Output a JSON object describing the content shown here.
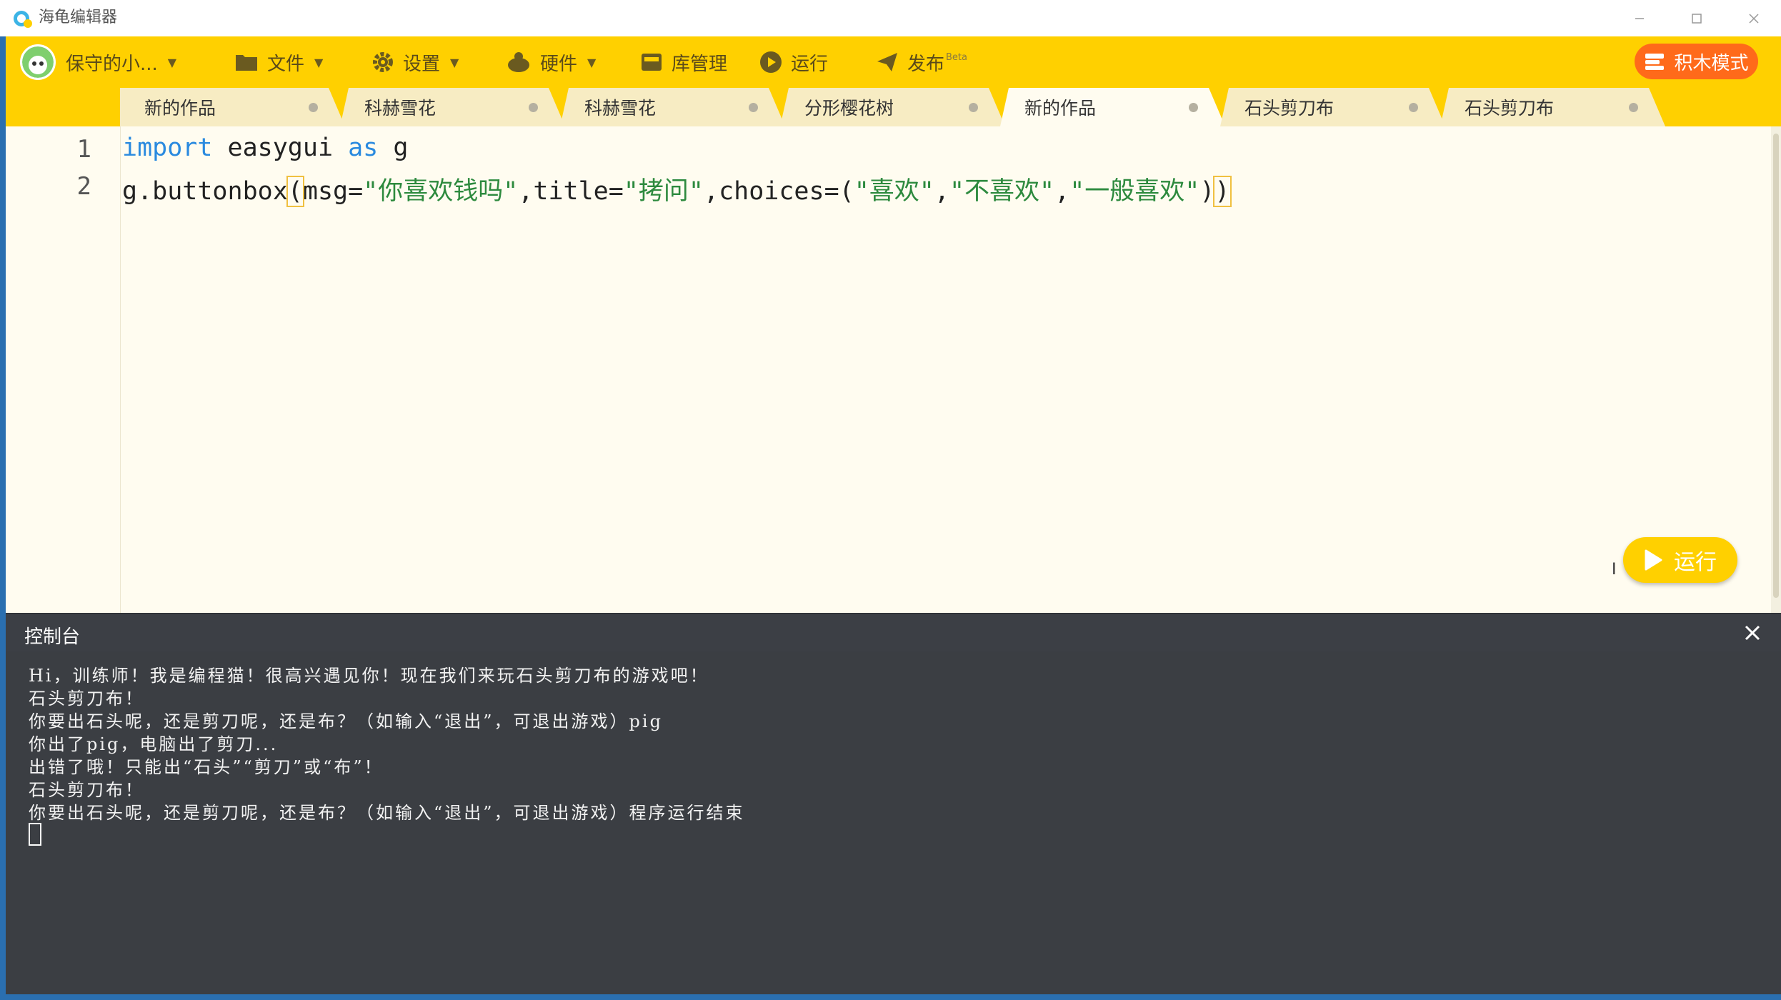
{
  "window": {
    "title": "海龟编辑器"
  },
  "toolbar": {
    "user": "保守的小...",
    "file": "文件",
    "settings": "设置",
    "hardware": "硬件",
    "library": "库管理",
    "run": "运行",
    "publish": "发布",
    "publish_badge": "Beta",
    "block_mode": "积木模式"
  },
  "tabs": [
    {
      "label": "新的作品"
    },
    {
      "label": "科赫雪花"
    },
    {
      "label": "科赫雪花"
    },
    {
      "label": "分形樱花树"
    },
    {
      "label": "新的作品",
      "active": true
    },
    {
      "label": "石头剪刀布"
    },
    {
      "label": "石头剪刀布"
    }
  ],
  "editor": {
    "line_numbers": [
      "1",
      "2"
    ],
    "line1": {
      "kw_import": "import",
      "module": " easygui ",
      "kw_as": "as",
      "alias": " g"
    },
    "line2": {
      "prefix": "g.buttonbox",
      "open": "(",
      "msg_key": "msg=",
      "msg_val": "\"你喜欢钱吗\"",
      "title_key": ",title=",
      "title_val": "\"拷问\"",
      "choices_key": ",choices=(",
      "c1": "\"喜欢\"",
      "sep1": ",",
      "c2": "\"不喜欢\"",
      "sep2": ",",
      "c3": "\"一般喜欢\"",
      "close_inner": ")",
      "close": ")"
    },
    "run_button": "运行"
  },
  "console": {
    "title": "控制台",
    "lines": [
      "Hi，训练师！我是编程猫！很高兴遇见你！现在我们来玩石头剪刀布的游戏吧！",
      "石头剪刀布！",
      "你要出石头呢，还是剪刀呢，还是布？（如输入“退出”，可退出游戏）pig",
      "你出了pig，电脑出了剪刀...",
      "出错了哦！只能出“石头”“剪刀”或“布”！",
      "石头剪刀布！",
      "你要出石头呢，还是剪刀呢，还是布？（如输入“退出”，可退出游戏）程序运行结束"
    ]
  },
  "colors": {
    "toolbar": "#ffd000",
    "editor_bg": "#fffcf0",
    "keyword": "#2a8adf",
    "string": "#2d8a3e",
    "console_bg": "#3b3e43",
    "block_mode_button": "#ff6a1a"
  }
}
